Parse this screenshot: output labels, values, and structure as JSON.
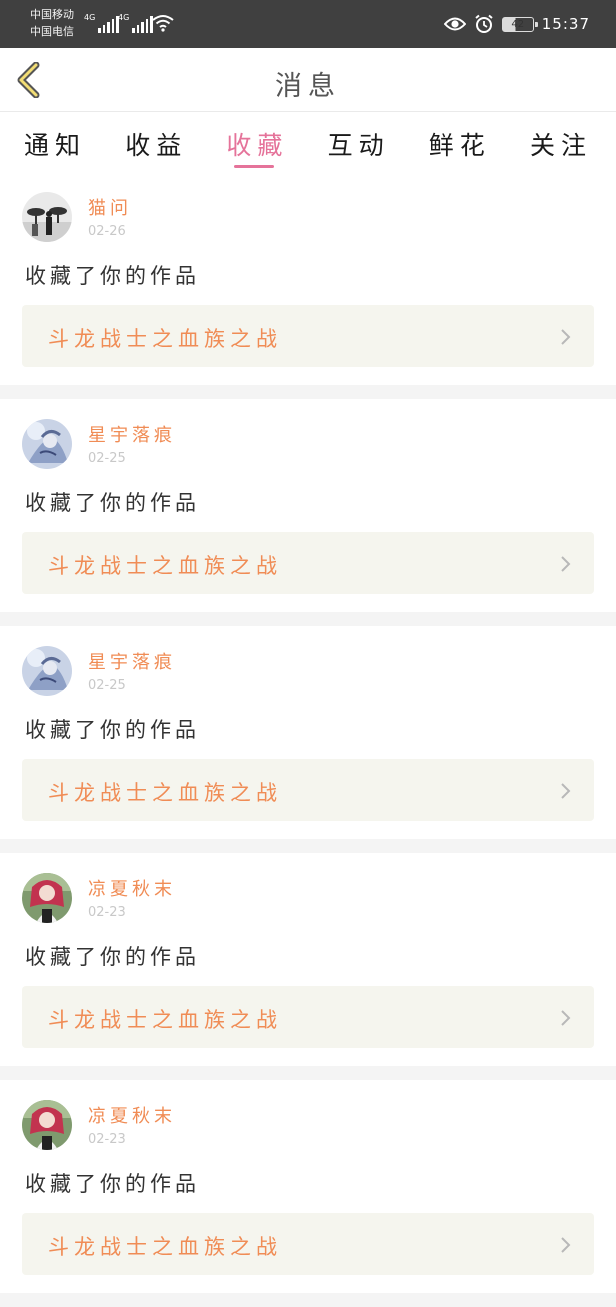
{
  "status_bar": {
    "carrier1": "中国移动",
    "carrier2": "中国电信",
    "network1": "4G",
    "network2": "4G",
    "battery": "42",
    "time": "15:37"
  },
  "header": {
    "title": "消息",
    "back_icon": "chevron-left-icon"
  },
  "tabs": [
    {
      "label": "通知",
      "active": false
    },
    {
      "label": "收益",
      "active": false
    },
    {
      "label": "收藏",
      "active": true
    },
    {
      "label": "互动",
      "active": false
    },
    {
      "label": "鲜花",
      "active": false
    },
    {
      "label": "关注",
      "active": false
    }
  ],
  "messages": [
    {
      "username": "猫问",
      "date": "02-26",
      "action": "收藏了你的作品",
      "work_title": "斗龙战士之血族之战"
    },
    {
      "username": "星宇落痕",
      "date": "02-25",
      "action": "收藏了你的作品",
      "work_title": "斗龙战士之血族之战"
    },
    {
      "username": "星宇落痕",
      "date": "02-25",
      "action": "收藏了你的作品",
      "work_title": "斗龙战士之血族之战"
    },
    {
      "username": "凉夏秋末",
      "date": "02-23",
      "action": "收藏了你的作品",
      "work_title": "斗龙战士之血族之战"
    },
    {
      "username": "凉夏秋末",
      "date": "02-23",
      "action": "收藏了你的作品",
      "work_title": "斗龙战士之血族之战"
    }
  ],
  "colors": {
    "accent": "#e5739a",
    "username": "#f08c55",
    "work_title": "#f08c55",
    "status_bar": "#404040",
    "card_link_bg": "#f5f5ee"
  }
}
